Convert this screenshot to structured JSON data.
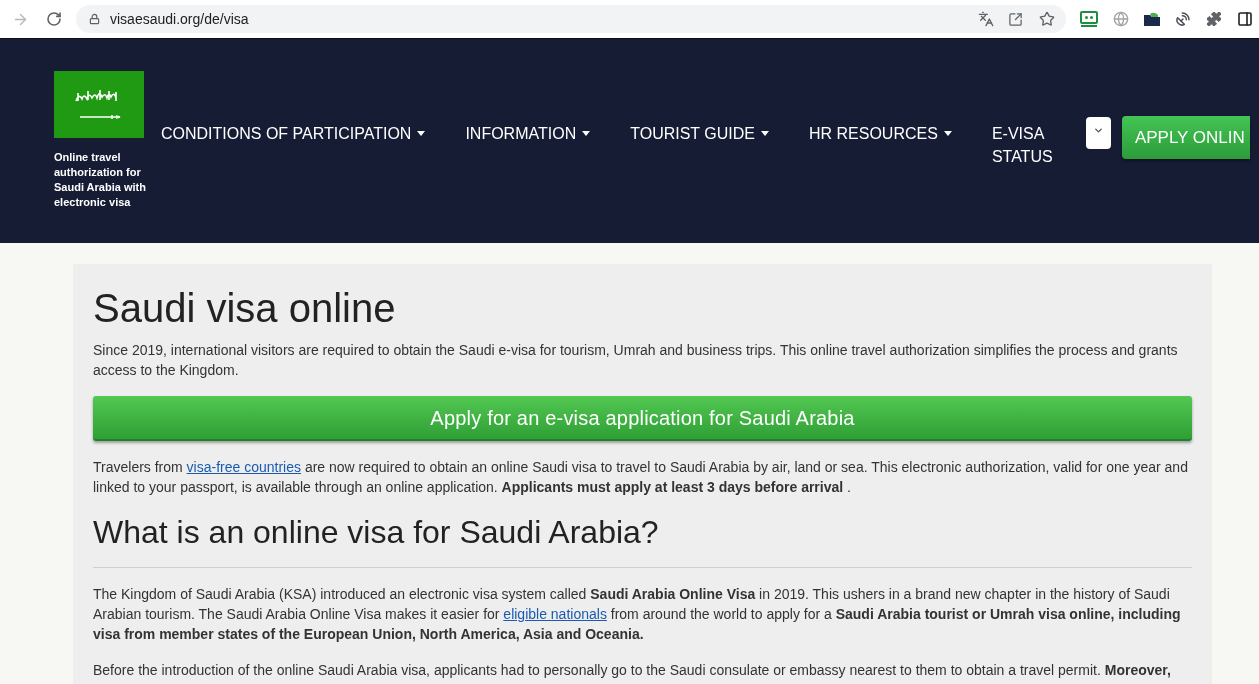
{
  "browser": {
    "forward_disabled": true,
    "url": "visaesaudi.org/de/visa"
  },
  "header": {
    "tagline": "Online travel authorization for Saudi Arabia with electronic visa",
    "nav": [
      {
        "kind": "dropdown",
        "label": "CONDITIONS OF PARTICIPATION"
      },
      {
        "kind": "dropdown",
        "label": "INFORMATION"
      },
      {
        "kind": "dropdown",
        "label": "TOURIST GUIDE"
      },
      {
        "kind": "dropdown",
        "label": "HR RESOURCES"
      },
      {
        "kind": "link",
        "label": "E-VISA STATUS"
      }
    ],
    "apply_button": "APPLY ONLIN"
  },
  "content": {
    "title": "Saudi visa online",
    "blocks": [
      {
        "kind": "paragraph",
        "parts": [
          {
            "kind": "text",
            "text": "Since 2019, international visitors are required to obtain the Saudi e-visa for tourism, Umrah and business trips. This online travel authorization simplifies the process and grants access to the Kingdom."
          }
        ]
      },
      {
        "kind": "button",
        "label": "Apply for an e-visa application for Saudi Arabia"
      },
      {
        "kind": "paragraph",
        "parts": [
          {
            "kind": "text",
            "text": "Travelers from "
          },
          {
            "kind": "link",
            "text": "visa-free countries"
          },
          {
            "kind": "text",
            "text": " are now required to obtain an online Saudi visa to travel to Saudi Arabia by air, land or sea. This electronic authorization, valid for one year and linked to your passport, is available through an online application. **Applicants must apply at least 3 days before arrival** ."
          }
        ]
      },
      {
        "kind": "heading",
        "text": "What is an online visa for Saudi Arabia?"
      },
      {
        "kind": "rule"
      },
      {
        "kind": "paragraph",
        "parts": [
          {
            "kind": "text",
            "text": "The Kingdom of Saudi Arabia (KSA) introduced an electronic visa system called **Saudi Arabia Online Visa** in 2019. This ushers in a brand new chapter in the history of Saudi Arabian tourism. The Saudi Arabia Online Visa makes it easier for "
          },
          {
            "kind": "link",
            "text": "eligible nationals"
          },
          {
            "kind": "text",
            "text": " from around the world to apply for a **Saudi Arabia tourist or Umrah visa online, including visa from member states of the European Union, North America, Asia and Oceania.**"
          }
        ]
      },
      {
        "kind": "paragraph",
        "parts": [
          {
            "kind": "text",
            "text": "Before the introduction of the online Saudi Arabia visa, applicants had to personally go to the Saudi consulate or embassy nearest to them to obtain a travel permit. **Moreover,**"
          }
        ]
      }
    ]
  }
}
